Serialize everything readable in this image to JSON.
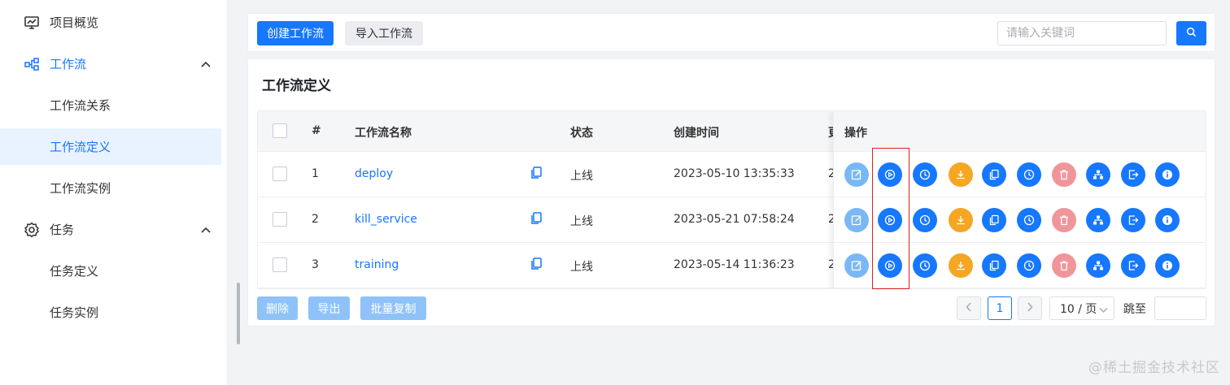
{
  "sidebar": {
    "items": [
      {
        "label": "项目概览",
        "icon": "monitor-chart-icon"
      },
      {
        "label": "工作流",
        "icon": "workflow-icon"
      },
      {
        "label": "工作流关系"
      },
      {
        "label": "工作流定义"
      },
      {
        "label": "工作流实例"
      },
      {
        "label": "任务",
        "icon": "gear-icon"
      },
      {
        "label": "任务定义"
      },
      {
        "label": "任务实例"
      }
    ]
  },
  "toolbar": {
    "create_label": "创建工作流",
    "import_label": "导入工作流",
    "search_placeholder": "请输入关键词"
  },
  "card": {
    "title": "工作流定义"
  },
  "table": {
    "headers": {
      "index": "#",
      "name": "工作流名称",
      "status": "状态",
      "created": "创建时间",
      "ops": "操作"
    },
    "rows": [
      {
        "index": "1",
        "name": "deploy",
        "status": "上线",
        "created": "2023-05-10 13:35:33",
        "trunc": "2"
      },
      {
        "index": "2",
        "name": "kill_service",
        "status": "上线",
        "created": "2023-05-21 07:58:24",
        "trunc": "2"
      },
      {
        "index": "3",
        "name": "training",
        "status": "上线",
        "created": "2023-05-14 11:36:23",
        "trunc": "2"
      }
    ],
    "action_icons": [
      "edit-icon",
      "run-icon",
      "timing-icon",
      "download-icon",
      "copy-icon",
      "timing-manage-icon",
      "delete-icon",
      "tree-icon",
      "export-icon",
      "info-icon"
    ]
  },
  "footer": {
    "delete_label": "删除",
    "export_label": "导出",
    "batch_copy_label": "批量复制",
    "current_page": "1",
    "page_size": "10 / 页",
    "jump_label": "跳至"
  },
  "watermark": "@稀土掘金技术社区",
  "colors": {
    "primary": "#1677ff",
    "orange": "#f5a623",
    "disabled_blue": "#7ab8f5",
    "disabled_red": "#f0969a",
    "highlight": "#e0201b"
  }
}
